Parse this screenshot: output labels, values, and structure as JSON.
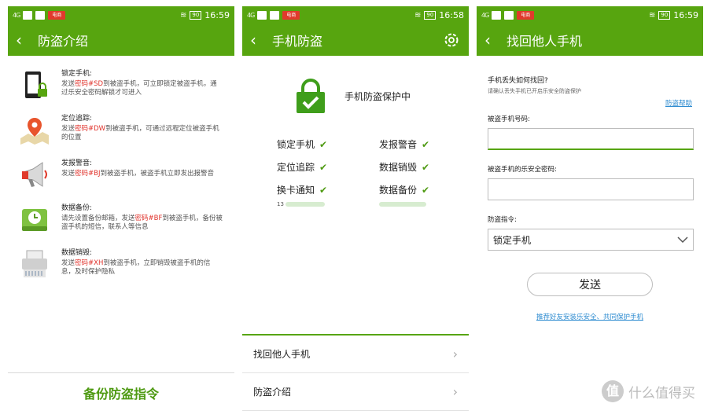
{
  "status": [
    {
      "signal": "4G",
      "battery": "90",
      "time": "16:59",
      "badge": "电商"
    },
    {
      "signal": "4G",
      "battery": "90",
      "time": "16:58",
      "badge": "电商"
    },
    {
      "signal": "4G",
      "battery": "90",
      "time": "16:59",
      "badge": "电商"
    }
  ],
  "screen1": {
    "title": "防盗介绍",
    "items": [
      {
        "head": "锁定手机:",
        "pre": "发送",
        "code": "密码#SD",
        "post": "到被盗手机，可立即锁定被盗手机，通过乐安全密码解锁才可进入",
        "icon": "phone-lock-icon"
      },
      {
        "head": "定位追踪:",
        "pre": "发送",
        "code": "密码#DW",
        "post": "到被盗手机，可通过远程定位被盗手机的位置",
        "icon": "map-pin-icon"
      },
      {
        "head": "发报警音:",
        "pre": "发送",
        "code": "密码#BJ",
        "post": "到被盗手机，被盗手机立即发出报警音",
        "icon": "megaphone-icon"
      },
      {
        "head": "数据备份:",
        "pre": "请先设置备份邮箱，发送",
        "code": "密码#BF",
        "post": "到被盗手机，备份被盗手机的短信，联系人等信息",
        "icon": "backup-drive-icon"
      },
      {
        "head": "数据销毁:",
        "pre": "发送",
        "code": "密码#XH",
        "post": "到被盗手机，立即销毁被盗手机的信息，及时保护隐私",
        "icon": "shredder-icon"
      }
    ],
    "bottom_button": "备份防盗指令"
  },
  "screen2": {
    "title": "手机防盗",
    "protect_text": "手机防盗保护中",
    "features": [
      "锁定手机",
      "发报警音",
      "定位追踪",
      "数据销毁",
      "换卡通知",
      "数据备份"
    ],
    "number_prefix": "13",
    "menu": [
      "找回他人手机",
      "防盗介绍"
    ]
  },
  "screen3": {
    "title": "找回他人手机",
    "question": "手机丢失如何找回?",
    "question_sub": "请确认丢失手机已开启乐安全防盗保护",
    "help_link": "防盗帮助",
    "label_number": "被盗手机号码:",
    "label_password": "被盗手机的乐安全密码:",
    "label_command": "防盗指令:",
    "command_value": "锁定手机",
    "send_button": "发送",
    "recommend_link": "推荐好友安装乐安全、共同保护手机"
  },
  "watermark": {
    "logo": "值",
    "text": "什么值得买"
  },
  "colors": {
    "brand_green": "#57a50f",
    "code_red": "#e0322b",
    "link_blue": "#2d8bd0"
  }
}
